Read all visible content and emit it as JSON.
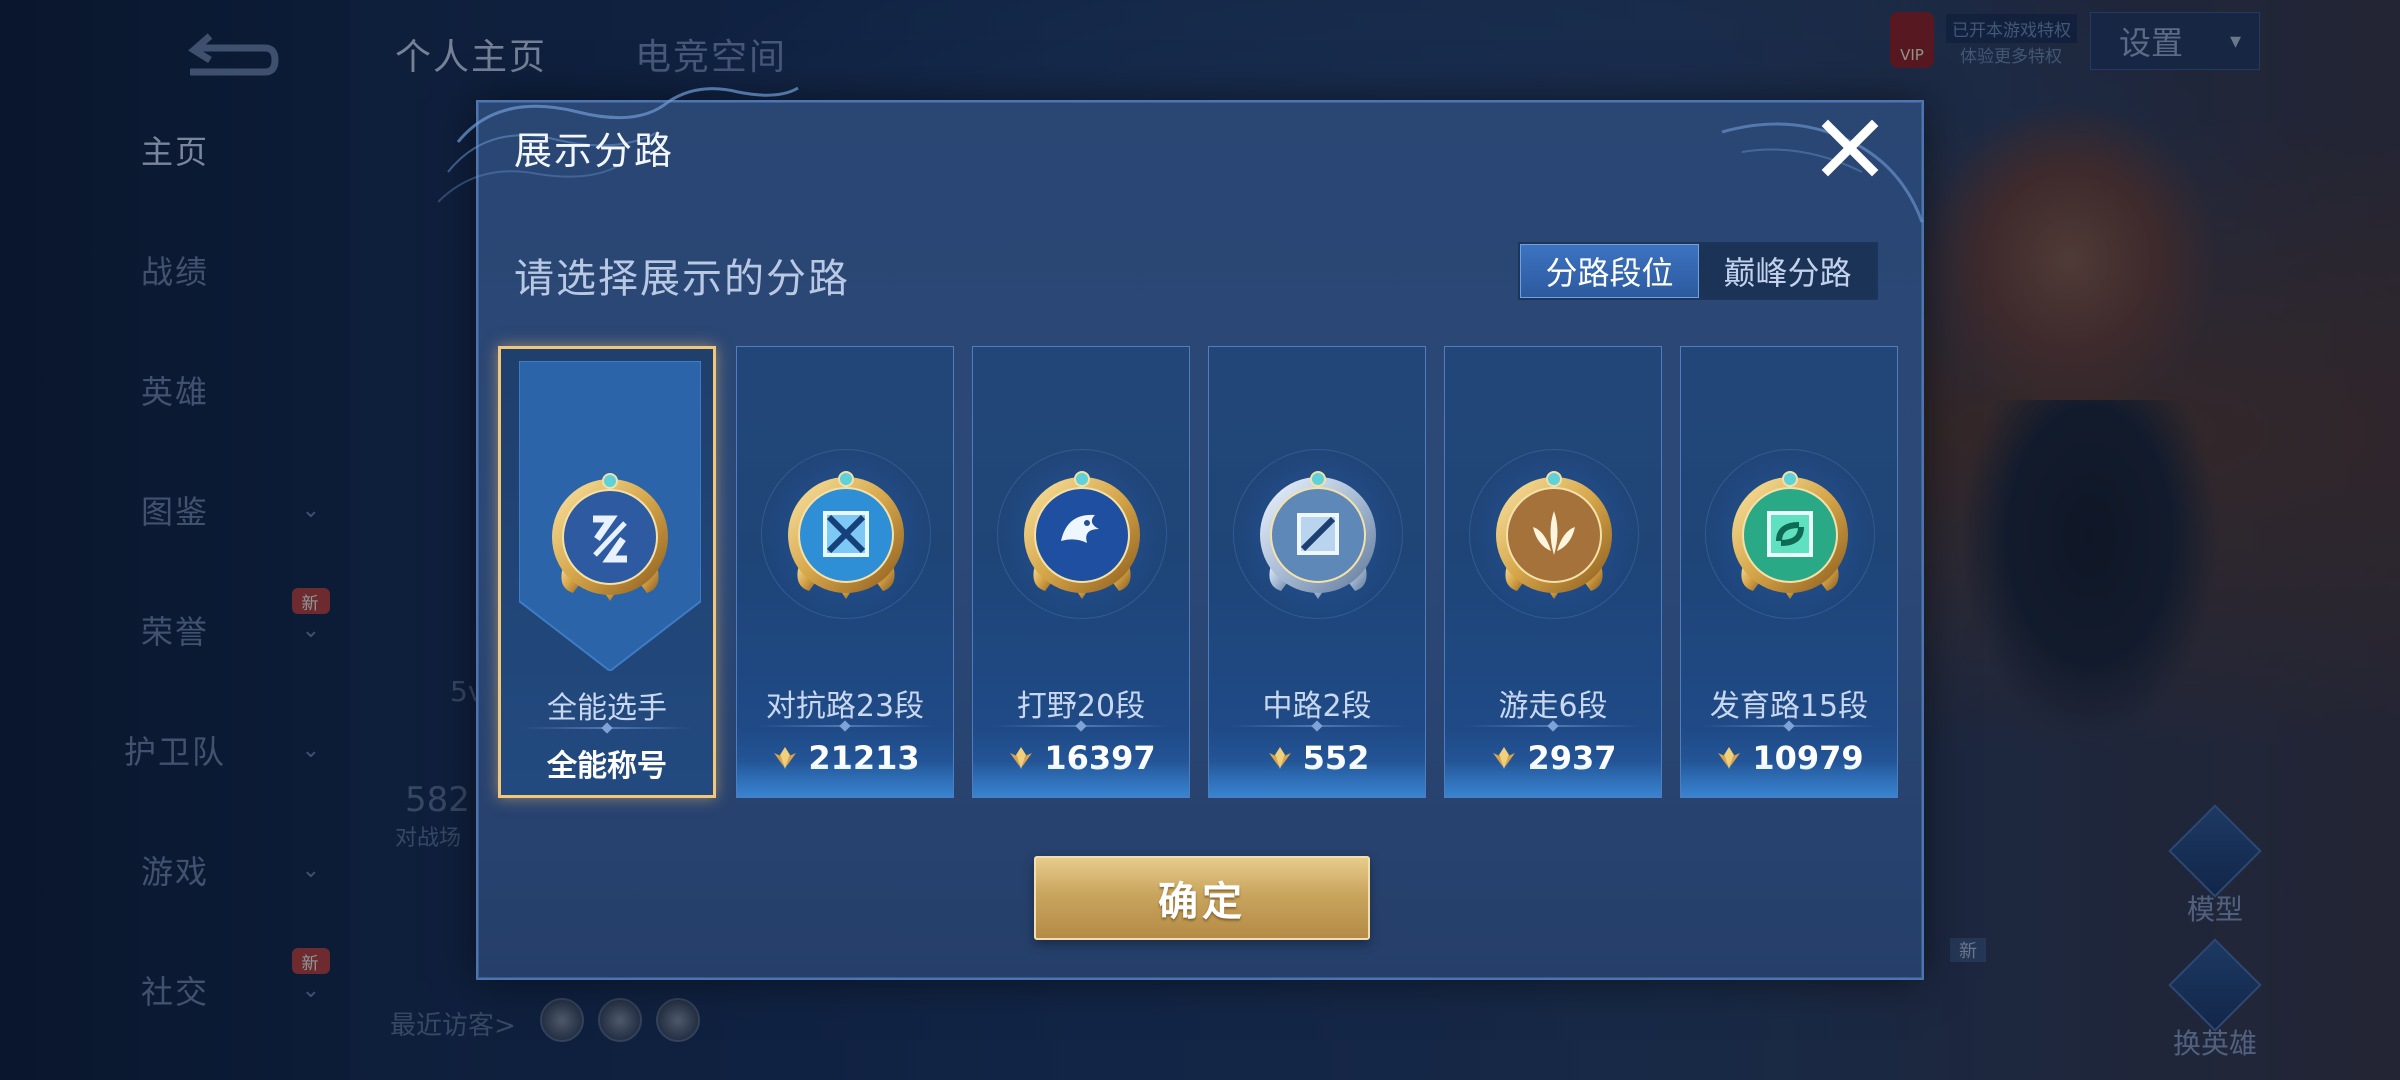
{
  "background": {
    "top_tabs": [
      "个人主页",
      "电竞空间"
    ],
    "sidebar": [
      {
        "label": "主页",
        "active": true,
        "chevron": false,
        "new": false
      },
      {
        "label": "战绩",
        "active": false,
        "chevron": false,
        "new": false
      },
      {
        "label": "英雄",
        "active": false,
        "chevron": false,
        "new": false
      },
      {
        "label": "图鉴",
        "active": false,
        "chevron": true,
        "new": false
      },
      {
        "label": "荣誉",
        "active": false,
        "chevron": true,
        "new": true
      },
      {
        "label": "护卫队",
        "active": false,
        "chevron": true,
        "new": false
      },
      {
        "label": "游戏",
        "active": false,
        "chevron": true,
        "new": false
      },
      {
        "label": "社交",
        "active": false,
        "chevron": true,
        "new": true
      }
    ],
    "new_badge": "新",
    "settings_label": "设置",
    "vip_label": "VIP",
    "vip_text_1": "已开本游戏特权",
    "vip_text_2": "体验更多特权",
    "stat_value": "582",
    "stat_label": "对战场",
    "small_stat": "5v",
    "visitors_label": "最近访客>",
    "right_buttons": [
      "模型",
      "换英雄"
    ]
  },
  "modal": {
    "title": "展示分路",
    "subtitle": "请选择展示的分路",
    "segmented": {
      "options": [
        "分路段位",
        "巅峰分路"
      ],
      "selected": 0
    },
    "cards": [
      {
        "name": "全能选手",
        "bottom": "全能称号",
        "type": "title",
        "selected": true,
        "emblem": "all-round-emblem-icon"
      },
      {
        "name": "对抗路23段",
        "score": "21213",
        "type": "score",
        "selected": false,
        "emblem": "clash-lane-emblem-icon"
      },
      {
        "name": "打野20段",
        "score": "16397",
        "type": "score",
        "selected": false,
        "emblem": "jungle-emblem-icon"
      },
      {
        "name": "中路2段",
        "score": "552",
        "type": "score",
        "selected": false,
        "emblem": "mid-lane-emblem-icon"
      },
      {
        "name": "游走6段",
        "score": "2937",
        "type": "score",
        "selected": false,
        "emblem": "roam-emblem-icon"
      },
      {
        "name": "发育路15段",
        "score": "10979",
        "type": "score",
        "selected": false,
        "emblem": "farm-lane-emblem-icon"
      }
    ],
    "confirm_label": "确定"
  },
  "colors": {
    "accent_gold": "#f2c77a",
    "segment_active": "#3d73c0",
    "modal_bg": "#2a4673"
  }
}
